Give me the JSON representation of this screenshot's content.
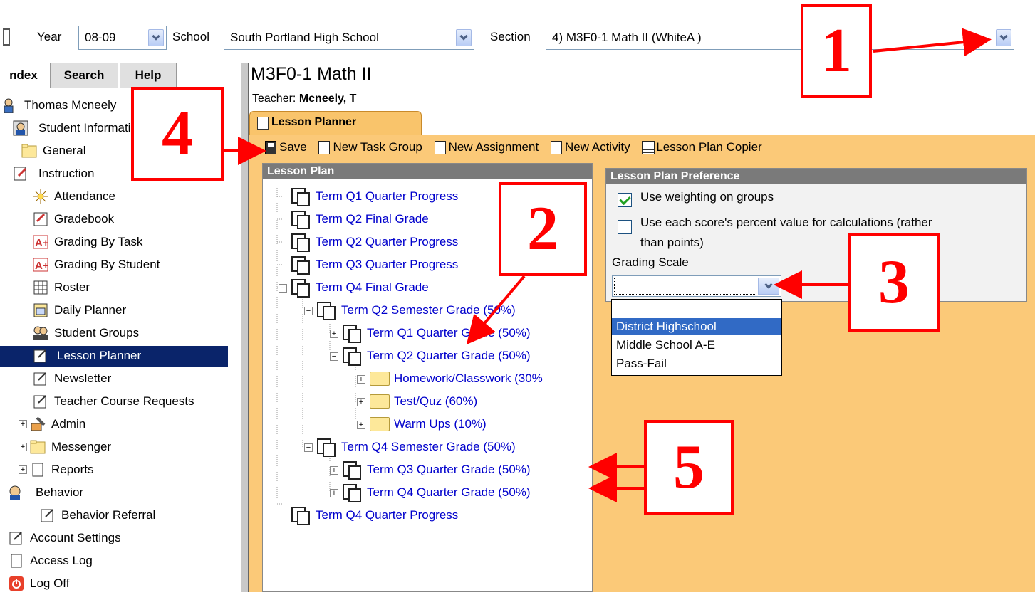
{
  "toolbar": {
    "year_label": "Year",
    "year_value": "08-09",
    "school_label": "School",
    "school_value": "South Portland High School",
    "section_label": "Section",
    "section_value": "4) M3F0-1 Math II (WhiteA )"
  },
  "sidebar": {
    "tabs": [
      "ndex",
      "Search",
      "Help"
    ],
    "items": [
      {
        "label": "Thomas Mcneely",
        "icon": "person-icon"
      },
      {
        "label": "Student Information",
        "icon": "student-info-icon"
      },
      {
        "label": "General",
        "icon": "folder-icon"
      },
      {
        "label": "Instruction",
        "icon": "instruction-icon"
      },
      {
        "label": "Attendance",
        "icon": "attendance-icon"
      },
      {
        "label": "Gradebook",
        "icon": "gradebook-icon"
      },
      {
        "label": "Grading By Task",
        "icon": "grade-a-icon"
      },
      {
        "label": "Grading By Student",
        "icon": "grade-a-icon"
      },
      {
        "label": "Roster",
        "icon": "roster-icon"
      },
      {
        "label": "Daily Planner",
        "icon": "calendar-icon"
      },
      {
        "label": "Student Groups",
        "icon": "group-icon"
      },
      {
        "label": "Lesson Planner",
        "icon": "note-icon"
      },
      {
        "label": "Newsletter",
        "icon": "note-icon"
      },
      {
        "label": "Teacher Course Requests",
        "icon": "note-icon"
      },
      {
        "label": "Admin",
        "icon": "tools-icon"
      },
      {
        "label": "Messenger",
        "icon": "folder-icon"
      },
      {
        "label": "Reports",
        "icon": "page-icon"
      },
      {
        "label": "Behavior",
        "icon": "behavior-icon"
      },
      {
        "label": "Behavior Referral",
        "icon": "note-icon"
      },
      {
        "label": "Account Settings",
        "icon": "note-icon"
      },
      {
        "label": "Access Log",
        "icon": "page-icon"
      },
      {
        "label": "Log Off",
        "icon": "power-icon"
      }
    ]
  },
  "main": {
    "course_title": "M3F0-1 Math II",
    "teacher_label": "Teacher:",
    "teacher_name": "Mcneely, T",
    "tab_label": "Lesson Planner",
    "actions": {
      "save": "Save",
      "new_task_group": "New Task Group",
      "new_assignment": "New Assignment",
      "new_activity": "New Activity",
      "copier": "Lesson Plan Copier"
    },
    "lesson_plan": {
      "header": "Lesson Plan",
      "items": [
        "Term Q1 Quarter Progress",
        "Term Q2 Final Grade",
        "Term Q2 Quarter Progress",
        "Term Q3 Quarter Progress",
        "Term Q4 Final Grade",
        "Term Q2 Semester Grade (50%)",
        "Term Q1 Quarter Grade (50%)",
        "Term Q2 Quarter Grade (50%)",
        "Homework/Classwork (30%",
        "Test/Quz (60%)",
        "Warm Ups (10%)",
        "Term Q4 Semester Grade (50%)",
        "Term Q3 Quarter Grade (50%)",
        "Term Q4 Quarter Grade (50%)",
        "Term Q4 Quarter Progress"
      ]
    },
    "preference": {
      "header": "Lesson Plan Preference",
      "weighting_label": "Use weighting on groups",
      "weighting_checked": true,
      "percent_label_line1": "Use each score's percent value for calculations (rather",
      "percent_label_line2": "than points)",
      "percent_checked": false,
      "grading_scale_label": "Grading Scale",
      "grading_scale_value": "",
      "options": [
        "",
        "District Highschool",
        "Middle School A-E",
        "Pass-Fail"
      ],
      "highlighted_option": "District Highschool"
    }
  },
  "callouts": [
    "1",
    "2",
    "3",
    "4",
    "5"
  ],
  "colors": {
    "annotation": "#ff0000",
    "panel_bg": "#fbc978",
    "selection": "#0a246a",
    "link": "#0000cc"
  }
}
